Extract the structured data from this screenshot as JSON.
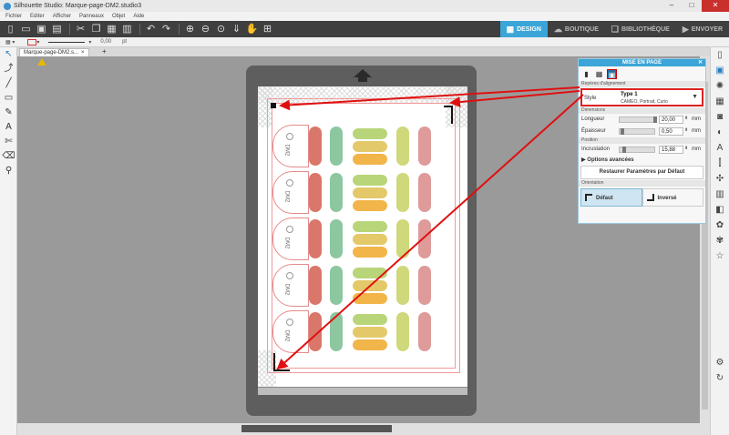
{
  "window": {
    "title": "Silhouette Studio: Marque-page-DM2.studio3"
  },
  "menu": [
    "Fichier",
    "Editer",
    "Afficher",
    "Panneaux",
    "Objet",
    "Aide"
  ],
  "nav_tabs": [
    {
      "label": "DESIGN",
      "icon": "grid-icon",
      "active": true
    },
    {
      "label": "BOUTIQUE",
      "icon": "cloud-icon",
      "active": false
    },
    {
      "label": "BIBLIOTHÈQUE",
      "icon": "library-icon",
      "active": false
    },
    {
      "label": "ENVOYER",
      "icon": "send-icon",
      "active": false
    }
  ],
  "propbar": {
    "line_value": "0,00",
    "line_unit": "pt"
  },
  "doc_tab": {
    "name": "Marque-page-DM2.s..."
  },
  "panel": {
    "title": "MISE EN PAGE",
    "section_reperes": "Repères d'alignement",
    "style_label": "Style",
    "style_value": "Type 1",
    "style_desc": "CAMEO, Portrait, Curio",
    "section_dimensions": "Dimensions",
    "longueur_label": "Longueur",
    "longueur_value": "20,00",
    "epaisseur_label": "Épaisseur",
    "epaisseur_value": "0,50",
    "section_position": "Position",
    "incrustation_label": "Incrustation",
    "incrustation_value": "15,88",
    "unit": "mm",
    "advanced": "Options avancées",
    "restore": "Restaurer Paramètres par Défaut",
    "section_orientation": "Orientation",
    "orient_default": "Défaut",
    "orient_inverse": "Inversé"
  },
  "tag_text": "DM2",
  "colors": {
    "accent": "#3ba5d8",
    "annotation": "#e01010"
  }
}
